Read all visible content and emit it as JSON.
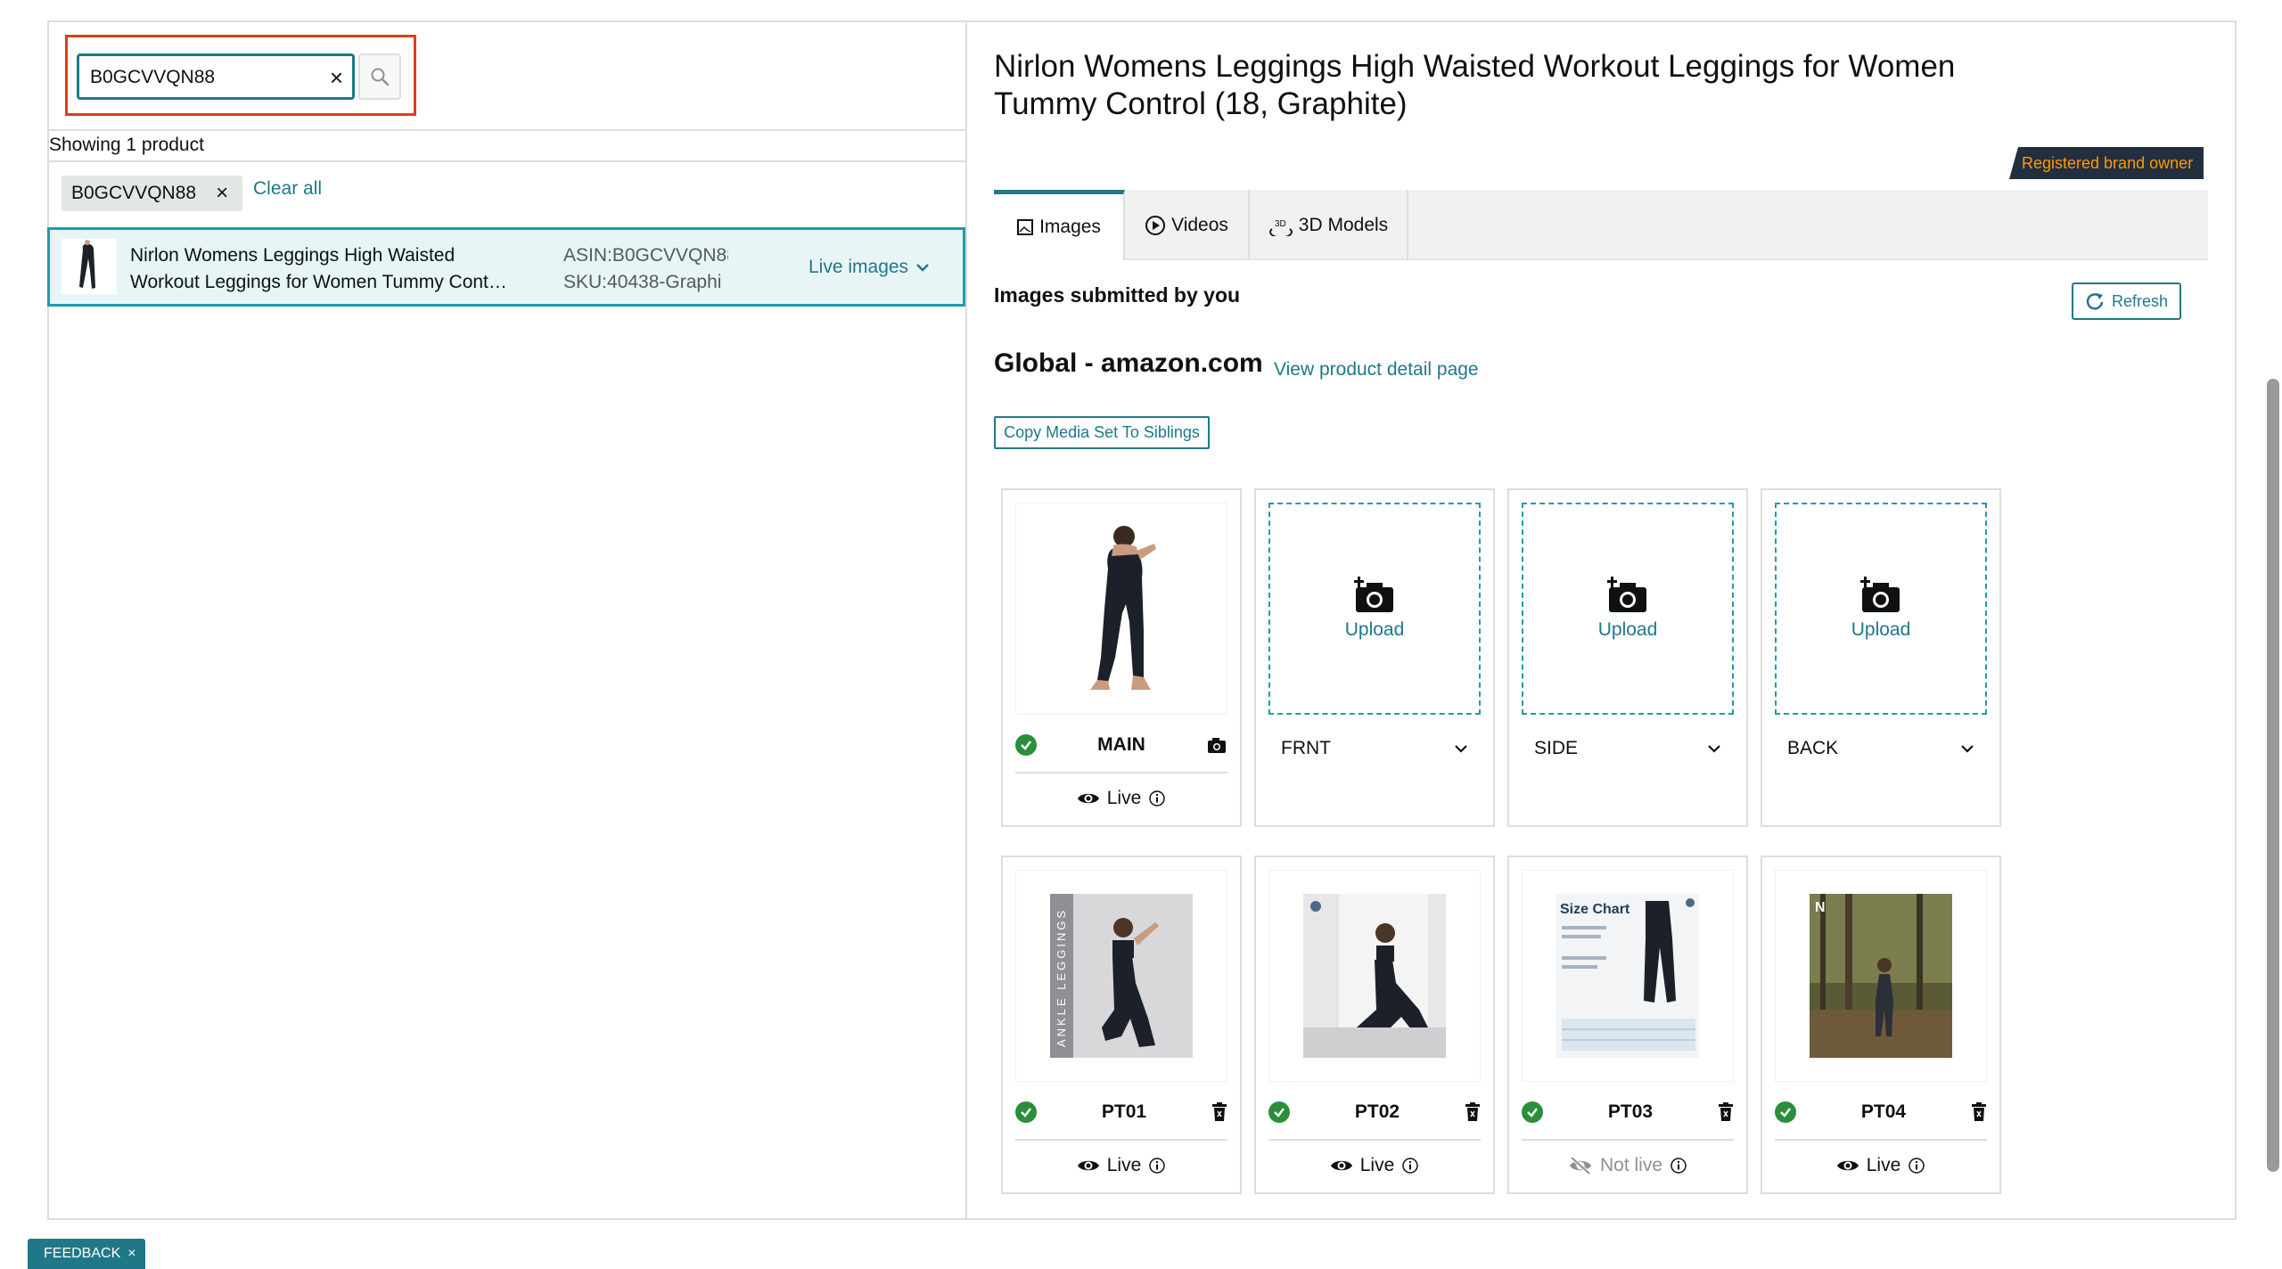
{
  "search": {
    "value": "B0GCVVQN88",
    "clear_label": "×"
  },
  "results": {
    "showing": "Showing 1 product",
    "chip_label": "B0GCVVQN88",
    "chip_remove": "×",
    "clear_all": "Clear all"
  },
  "product_row": {
    "title_line1": "Nirlon Womens Leggings High Waisted",
    "title_line2": "Workout Leggings for Women Tummy Cont…",
    "asin": "ASIN:B0GCVVQN88",
    "sku": "SKU:40438-Graphi",
    "status_dropdown": "Live images"
  },
  "detail": {
    "title": "Nirlon Womens Leggings High Waisted Workout Leggings for Women Tummy Control (18, Graphite)",
    "brand_badge": "Registered brand owner",
    "tabs": [
      {
        "label": "Images",
        "icon": "image-icon"
      },
      {
        "label": "Videos",
        "icon": "play-icon"
      },
      {
        "label": "3D Models",
        "icon": "3d-icon"
      }
    ],
    "images_heading": "Images submitted by you",
    "refresh_label": "Refresh",
    "marketplace": "Global - amazon.com",
    "view_pdp": "View product detail page",
    "copy_media": "Copy Media Set To Siblings"
  },
  "image_slots": [
    {
      "code": "MAIN",
      "type": "image",
      "status": "Live",
      "action_icon": "camera-icon"
    },
    {
      "code": "FRNT",
      "type": "upload",
      "upload_label": "Upload"
    },
    {
      "code": "SIDE",
      "type": "upload",
      "upload_label": "Upload"
    },
    {
      "code": "BACK",
      "type": "upload",
      "upload_label": "Upload"
    },
    {
      "code": "PT01",
      "type": "image",
      "status": "Live",
      "action_icon": "trash-icon"
    },
    {
      "code": "PT02",
      "type": "image",
      "status": "Live",
      "action_icon": "trash-icon"
    },
    {
      "code": "PT03",
      "type": "image",
      "status": "Not live",
      "action_icon": "trash-icon",
      "size_chart_title": "Size Chart"
    },
    {
      "code": "PT04",
      "type": "image",
      "status": "Live",
      "action_icon": "trash-icon"
    }
  ],
  "pt01_side_text": "ANKLE LEGGINGS",
  "feedback": {
    "label": "FEEDBACK",
    "close": "×"
  },
  "colors": {
    "accent": "#1f7888",
    "badge_bg": "#232f3e",
    "badge_text": "#ff9900",
    "live_check": "#2a8e3a",
    "highlight_border": "#e03e1a"
  }
}
